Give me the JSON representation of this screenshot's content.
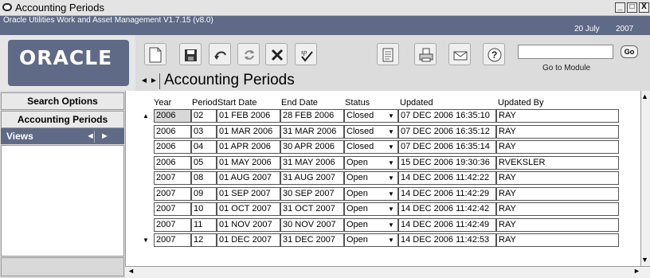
{
  "window": {
    "title": "Accounting Periods",
    "controls": [
      "_",
      "□",
      "X"
    ]
  },
  "product_bar": {
    "product": "Oracle Utilities Work and Asset Management V1.7.15 (v8.0)",
    "date": "20 July",
    "year": "2007"
  },
  "logo": "ORACLE",
  "toolbar": {
    "buttons": [
      "new-document-icon",
      "save-icon",
      "undo-icon",
      "refresh-icon",
      "delete-icon",
      "spell-check-icon",
      "report-icon",
      "print-icon",
      "mail-icon",
      "help-icon"
    ],
    "goto_value": "",
    "goto_label": "Go to Module",
    "go_label": "Go"
  },
  "nav": {
    "prev": "◄",
    "next": "►",
    "title": "Accounting Periods"
  },
  "sidebar": {
    "search_options": "Search Options",
    "accounting_periods": "Accounting Periods",
    "views": "Views"
  },
  "columns": [
    "Year",
    "Period",
    "Start Date",
    "End Date",
    "Status",
    "Updated",
    "Updated By"
  ],
  "rows": [
    [
      "2006",
      "02",
      "01 FEB 2006",
      "28 FEB 2006",
      "Closed",
      "07 DEC 2006 16:35:10",
      "RAY"
    ],
    [
      "2006",
      "03",
      "01 MAR 2006",
      "31 MAR 2006",
      "Closed",
      "07 DEC 2006 16:35:12",
      "RAY"
    ],
    [
      "2006",
      "04",
      "01 APR 2006",
      "30 APR 2006",
      "Closed",
      "07 DEC 2006 16:35:14",
      "RAY"
    ],
    [
      "2006",
      "05",
      "01 MAY 2006",
      "31 MAY 2006",
      "Open",
      "15 DEC 2006 19:30:36",
      "RVEKSLER"
    ],
    [
      "2007",
      "08",
      "01 AUG 2007",
      "31 AUG 2007",
      "Open",
      "14 DEC 2006 11:42:22",
      "RAY"
    ],
    [
      "2007",
      "09",
      "01 SEP 2007",
      "30 SEP 2007",
      "Open",
      "14 DEC 2006 11:42:29",
      "RAY"
    ],
    [
      "2007",
      "10",
      "01 OCT 2007",
      "31 OCT 2007",
      "Open",
      "14 DEC 2006 11:42:42",
      "RAY"
    ],
    [
      "2007",
      "11",
      "01 NOV 2007",
      "30 NOV 2007",
      "Open",
      "14 DEC 2006 11:42:49",
      "RAY"
    ],
    [
      "2007",
      "12",
      "01 DEC 2007",
      "31 DEC 2007",
      "Open",
      "14 DEC 2006 11:42:53",
      "RAY"
    ]
  ],
  "colors": {
    "accent": "#5e6a86"
  }
}
